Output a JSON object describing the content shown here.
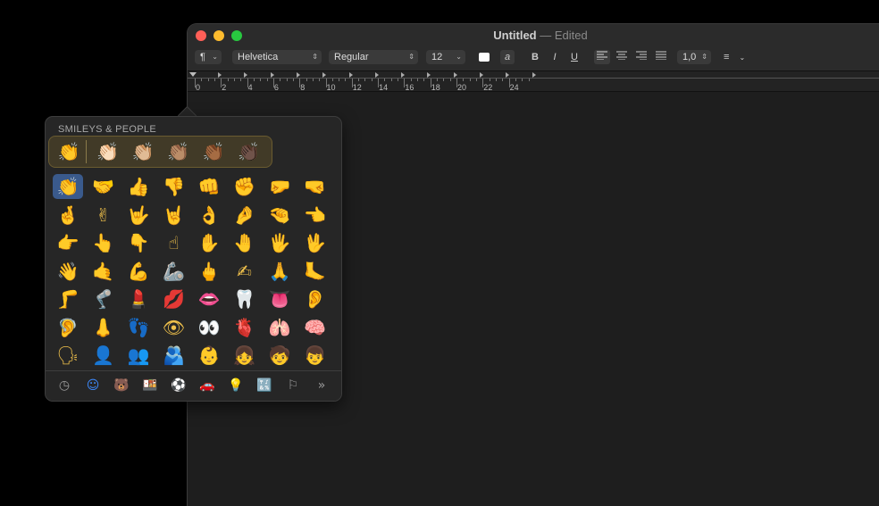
{
  "window": {
    "title": "Untitled",
    "title_sep": "—",
    "status": "Edited"
  },
  "toolbar": {
    "paragraph_icon": "¶",
    "font_family": "Helvetica",
    "font_style": "Regular",
    "font_size": "12",
    "color_icon": "text-color-swatch",
    "bg_icon": "a",
    "bold": "B",
    "italic": "I",
    "underline": "U",
    "line_spacing": "1,0",
    "list_icon": "≡"
  },
  "ruler": {
    "labels": [
      "0",
      "2",
      "4",
      "6",
      "8",
      "10",
      "12",
      "14",
      "16",
      "18",
      "20",
      "22",
      "24"
    ]
  },
  "emoji_picker": {
    "category_title": "SMILEYS & PEOPLE",
    "skin_tones": [
      "👏",
      "👏🏻",
      "👏🏼",
      "👏🏽",
      "👏🏾",
      "👏🏿"
    ],
    "emojis": [
      [
        "👏",
        "🤝",
        "👍",
        "👎",
        "👊",
        "✊",
        "🤛",
        "🤜"
      ],
      [
        "🤞",
        "✌",
        "🤟",
        "🤘",
        "👌",
        "🤌",
        "🤏",
        "👈"
      ],
      [
        "👉",
        "👆",
        "👇",
        "☝",
        "✋",
        "🤚",
        "🖐",
        "🖖"
      ],
      [
        "👋",
        "🤙",
        "💪",
        "🦾",
        "🖕",
        "✍",
        "🙏",
        "🦶"
      ],
      [
        "🦵",
        "🦿",
        "💄",
        "💋",
        "👄",
        "🦷",
        "👅",
        "👂"
      ],
      [
        "🦻",
        "👃",
        "👣",
        "👁",
        "👀",
        "🫀",
        "🫁",
        "🧠"
      ],
      [
        "🗣",
        "👤",
        "👥",
        "🫂",
        "👶",
        "👧",
        "🧒",
        "👦"
      ]
    ],
    "categories": [
      {
        "name": "recent-icon",
        "glyph": "◷"
      },
      {
        "name": "smileys-icon",
        "glyph": "☺"
      },
      {
        "name": "animals-icon",
        "glyph": "🐻"
      },
      {
        "name": "food-icon",
        "glyph": "🍱"
      },
      {
        "name": "activity-icon",
        "glyph": "⚽"
      },
      {
        "name": "travel-icon",
        "glyph": "🚗"
      },
      {
        "name": "objects-icon",
        "glyph": "💡"
      },
      {
        "name": "symbols-icon",
        "glyph": "🔣"
      },
      {
        "name": "flags-icon",
        "glyph": "⚐"
      },
      {
        "name": "more-icon",
        "glyph": "»"
      }
    ]
  }
}
